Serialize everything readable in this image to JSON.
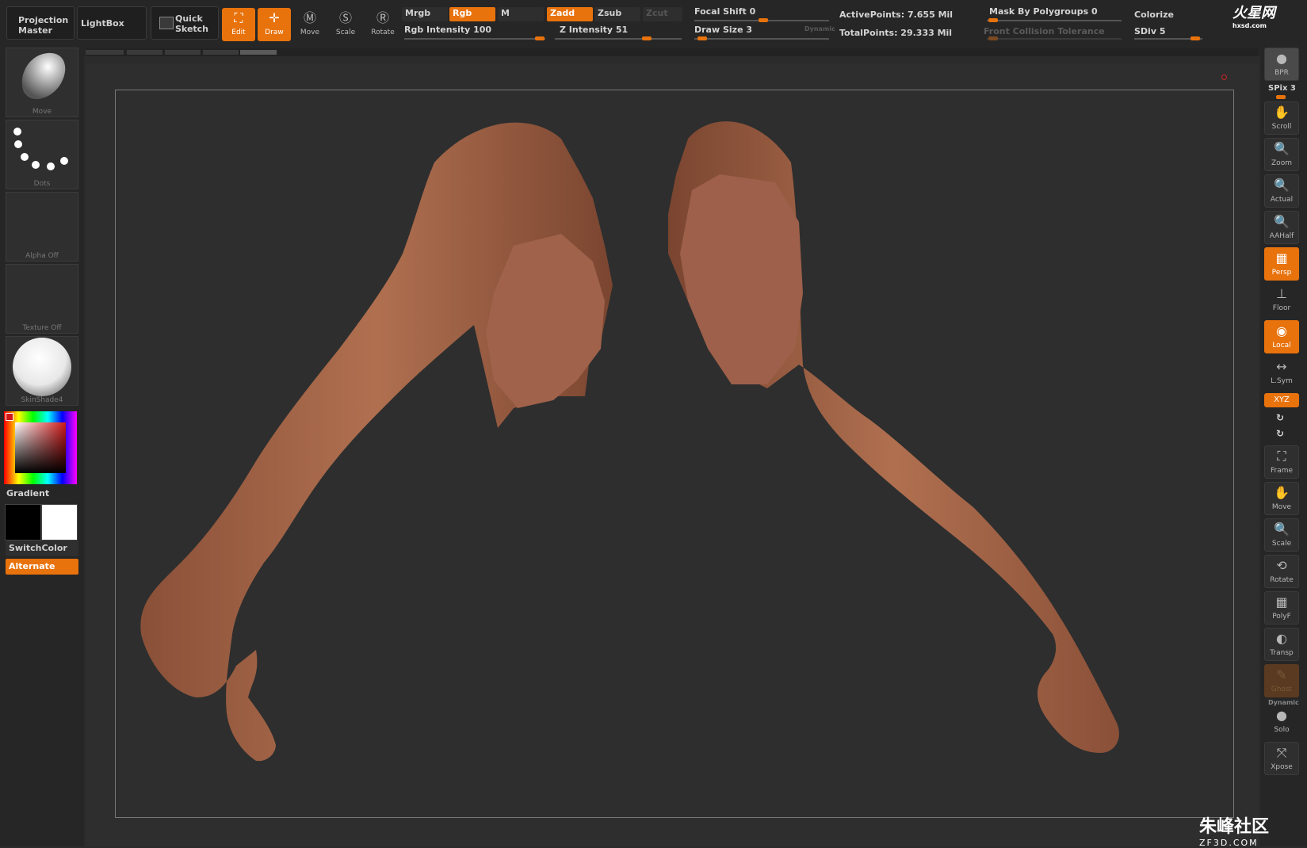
{
  "topbar": {
    "projection_master": [
      "Projection",
      "Master"
    ],
    "lightbox": "LightBox",
    "quick_sketch": [
      "Quick",
      "Sketch"
    ],
    "tools": [
      {
        "label": "Edit",
        "active": true
      },
      {
        "label": "Draw",
        "active": true
      },
      {
        "label": "Move",
        "active": false
      },
      {
        "label": "Scale",
        "active": false
      },
      {
        "label": "Rotate",
        "active": false
      }
    ],
    "mrgb": "Mrgb",
    "rgb": "Rgb",
    "m": "M",
    "zadd": "Zadd",
    "zsub": "Zsub",
    "zcut": "Zcut",
    "rgb_intensity": "Rgb Intensity 100",
    "z_intensity": "Z Intensity 51",
    "focal_shift": "Focal Shift 0",
    "draw_size": "Draw Size 3",
    "dynamic": "Dynamic",
    "active_points": "ActivePoints: 7.655 Mil",
    "total_points": "TotalPoints: 29.333 Mil",
    "mask_polygroups": "Mask By Polygroups 0",
    "front_collision": "Front Collision Tolerance",
    "colorize": "Colorize",
    "sdiv": "SDiv 5",
    "logo_text": "火星网",
    "logo_sub": "hxsd.com"
  },
  "leftshelf": {
    "brush": "Move",
    "stroke": "Dots",
    "alpha": "Alpha Off",
    "texture": "Texture Off",
    "material": "SkinShade4",
    "gradient": "Gradient",
    "switchcolor": "SwitchColor",
    "alternate": "Alternate"
  },
  "rightshelf": {
    "bpr": "BPR",
    "spix": "SPix 3",
    "buttons": [
      {
        "label": "Scroll",
        "on": false
      },
      {
        "label": "Zoom",
        "on": false
      },
      {
        "label": "Actual",
        "on": false
      },
      {
        "label": "AAHalf",
        "on": false
      },
      {
        "label": "Persp",
        "on": true
      },
      {
        "label": "Floor",
        "on": false
      },
      {
        "label": "Local",
        "on": true
      },
      {
        "label": "L.Sym",
        "on": false
      },
      {
        "label": "XYZ",
        "on": true
      },
      {
        "label": "Frame",
        "on": false
      },
      {
        "label": "Move",
        "on": false
      },
      {
        "label": "Scale",
        "on": false
      },
      {
        "label": "Rotate",
        "on": false
      },
      {
        "label": "PolyF",
        "on": false
      },
      {
        "label": "Transp",
        "on": false
      },
      {
        "label": "Ghost",
        "on": false
      },
      {
        "label": "Solo",
        "on": false
      },
      {
        "label": "Xpose",
        "on": false
      }
    ],
    "dynamic": "Dynamic"
  },
  "watermark": {
    "text": "朱峰社区",
    "sub": "ZF3D.COM"
  },
  "colors": {
    "accent": "#e8720c",
    "skin": "#a8684a",
    "background": "#2e2e2e"
  }
}
